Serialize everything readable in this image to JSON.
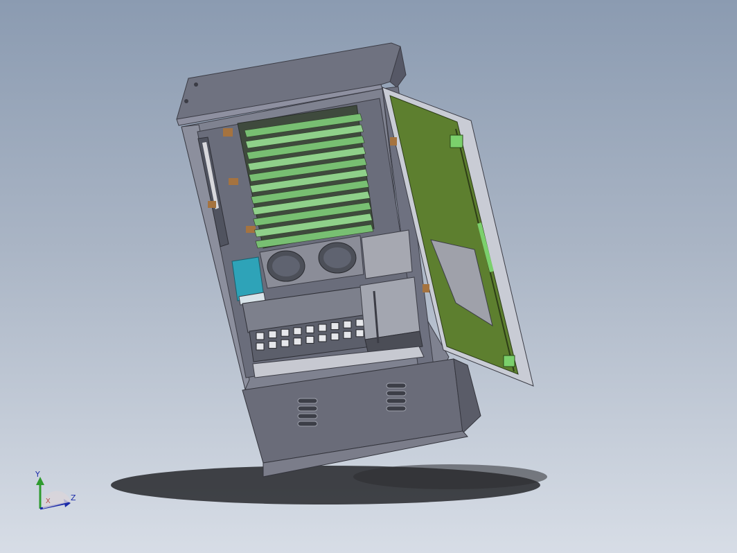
{
  "view": {
    "background_top": "#8b9bb1",
    "background_bottom": "#d7dde6",
    "model": "cabinet-3d-model"
  },
  "triad": {
    "y_label": "Y",
    "z_label": "Z",
    "x_marker": "X"
  },
  "colors": {
    "cabinet_body": "#7f8290",
    "cabinet_dark": "#5d6070",
    "door_green": "#5d7f2f",
    "tray_green": "#8fd08a",
    "accent_blue": "#2ea3b8"
  }
}
